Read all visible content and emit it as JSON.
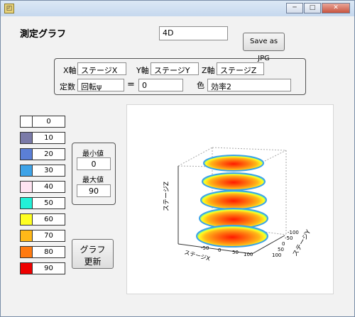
{
  "window": {
    "app_icon": "app-icon",
    "min_icon": "minimize-icon",
    "max_icon": "maximize-icon",
    "close_icon": "close-icon"
  },
  "header": {
    "title": "測定グラフ",
    "name_value": "4D",
    "save_button": "Save as JPG"
  },
  "axes_panel": {
    "x_label": "X軸",
    "x_value": "ステージX",
    "y_label": "Y軸",
    "y_value": "ステージY",
    "z_label": "Z軸",
    "z_value": "ステージZ",
    "const_label": "定数",
    "const_value": "回転ψ",
    "equals": "=",
    "const_number": "0",
    "color_label": "色",
    "color_value": "効率2"
  },
  "legend": [
    {
      "value": "0",
      "color": "#ffffff"
    },
    {
      "value": "10",
      "color": "#7a7aa8"
    },
    {
      "value": "20",
      "color": "#5b7fd6"
    },
    {
      "value": "30",
      "color": "#3da3e8"
    },
    {
      "value": "40",
      "color": "#ffe4f2"
    },
    {
      "value": "50",
      "color": "#22f0d8"
    },
    {
      "value": "60",
      "color": "#ffff22"
    },
    {
      "value": "70",
      "color": "#ffb818"
    },
    {
      "value": "80",
      "color": "#ff7a10"
    },
    {
      "value": "90",
      "color": "#ee0000"
    }
  ],
  "range": {
    "min_label": "最小値",
    "min_value": "0",
    "max_label": "最大値",
    "max_value": "90"
  },
  "update_button": {
    "line1": "グラフ",
    "line2": "更新"
  },
  "plot": {
    "z_axis_label": "ステージZ",
    "y_axis_label": "ステージY",
    "x_axis_label": "ステージX",
    "y_ticks": [
      "-100",
      "-50",
      "0",
      "50",
      "100"
    ],
    "x_ticks": [
      "-50",
      "0",
      "50",
      "100"
    ]
  }
}
